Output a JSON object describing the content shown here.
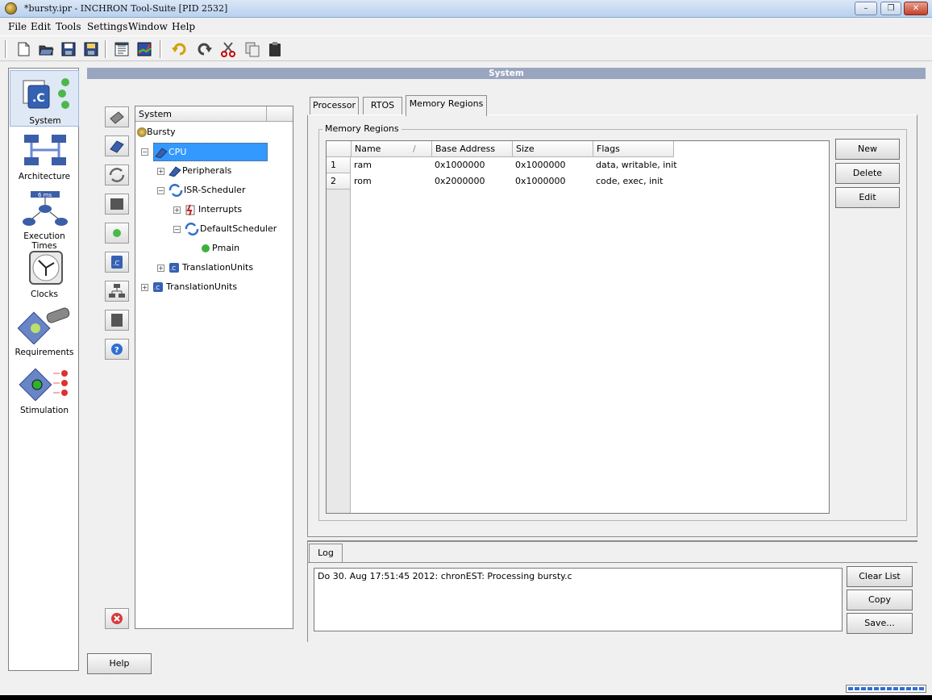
{
  "window": {
    "title": "*bursty.ipr - INCHRON Tool-Suite [PID 2532]",
    "controls": {
      "minimize": "–",
      "restore": "❐",
      "close": "✕"
    }
  },
  "menu": [
    {
      "label": "File"
    },
    {
      "label": "Edit"
    },
    {
      "label": "Tools"
    },
    {
      "label": "Settings"
    },
    {
      "label": "Window"
    },
    {
      "label": "Help"
    }
  ],
  "toolbar": [
    "new-icon",
    "open-icon",
    "save-icon",
    "save-all-icon",
    "properties-icon",
    "chart-icon",
    "undo-icon",
    "redo-icon",
    "cut-icon",
    "copy-icon",
    "paste-icon"
  ],
  "outline": [
    {
      "label": "System"
    },
    {
      "label": "Architecture"
    },
    {
      "label": "Execution Times"
    },
    {
      "label": "Clocks"
    },
    {
      "label": "Requirements"
    },
    {
      "label": "Stimulation"
    }
  ],
  "exec_times_badge": "6 ms",
  "header": {
    "title": "System"
  },
  "tree": {
    "column": "System",
    "nodes": [
      {
        "label": "Bursty"
      },
      {
        "label": "CPU"
      },
      {
        "label": "Peripherals"
      },
      {
        "label": "ISR-Scheduler"
      },
      {
        "label": "Interrupts"
      },
      {
        "label": "DefaultScheduler"
      },
      {
        "label": "Pmain"
      },
      {
        "label": "TranslationUnits"
      },
      {
        "label": "TranslationUnits"
      }
    ]
  },
  "tabs": [
    {
      "label": "Processor"
    },
    {
      "label": "RTOS"
    },
    {
      "label": "Memory Regions",
      "active": true
    }
  ],
  "memory_regions": {
    "group_label": "Memory Regions",
    "columns": [
      "Name",
      "Base Address",
      "Size",
      "Flags"
    ],
    "rows": [
      {
        "index": "1",
        "name": "ram",
        "base": "0x1000000",
        "size": "0x1000000",
        "flags": "data, writable, init"
      },
      {
        "index": "2",
        "name": "rom",
        "base": "0x2000000",
        "size": "0x1000000",
        "flags": "code, exec, init"
      }
    ],
    "buttons": {
      "new": "New",
      "delete": "Delete",
      "edit": "Edit"
    }
  },
  "log": {
    "tab": "Log",
    "entries": [
      "Do 30. Aug 17:51:45 2012: chronEST: Processing  bursty.c"
    ],
    "buttons": {
      "clear": "Clear List",
      "copy": "Copy",
      "save": "Save..."
    }
  },
  "footer": {
    "help": "Help"
  }
}
